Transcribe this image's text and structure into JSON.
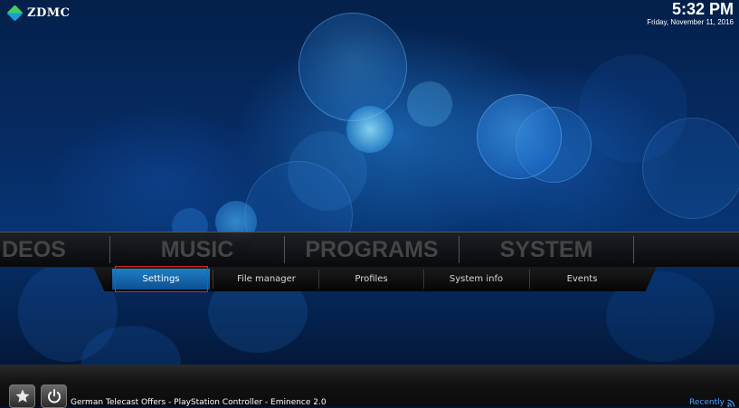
{
  "header": {
    "logo_text": "ZDMC",
    "time": "5:32 PM",
    "date": "Friday, November 11, 2016"
  },
  "main_menu": {
    "items": [
      "DEOS",
      "MUSIC",
      "PROGRAMS",
      "SYSTEM"
    ]
  },
  "submenu": {
    "items": [
      "Settings",
      "File manager",
      "Profiles",
      "System info",
      "Events"
    ],
    "focused": "Settings"
  },
  "footer": {
    "ticker": "German Telecast Offers - PlayStation Controller - Eminence 2.0",
    "recently_label": "Recently",
    "favourites_icon": "star-icon",
    "power_icon": "power-icon"
  },
  "colors": {
    "accent": "#1e7fc4",
    "focus_outline": "#d32626",
    "link": "#4aa3ff"
  }
}
